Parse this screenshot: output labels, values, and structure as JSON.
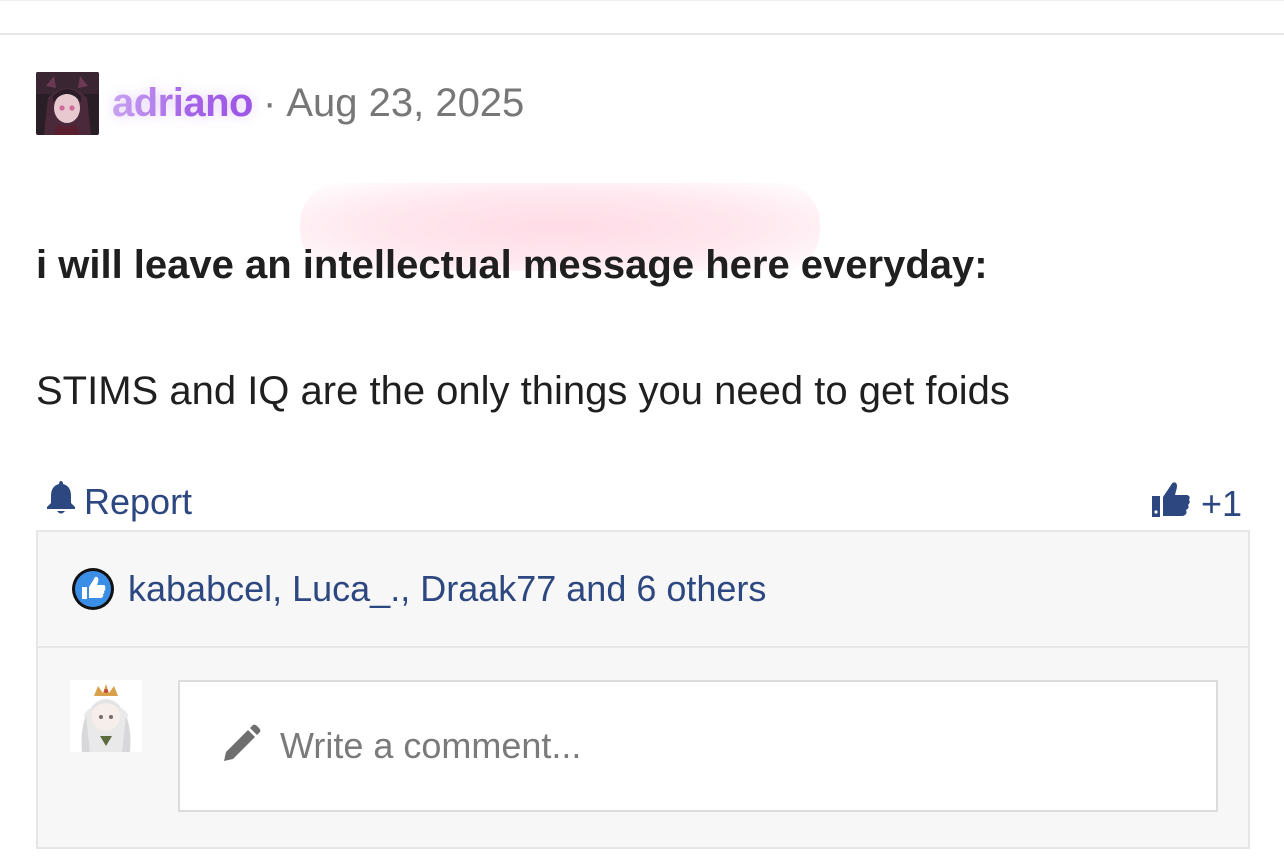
{
  "post": {
    "author": "adriano",
    "separator": "·",
    "date": "Aug 23, 2025",
    "title": "i will leave an intellectual message here everyday:",
    "body": "STIMS and IQ are the only things you need to get foids"
  },
  "actions": {
    "report_label": "Report",
    "report_icon": "bell-icon",
    "like_count": "+1",
    "like_icon": "thumbs-up-icon"
  },
  "reactions": {
    "icon": "like-badge-icon",
    "summary": "kababcel, Luca_., Draak77 and 6 others"
  },
  "comment_box": {
    "placeholder": "Write a comment...",
    "icon": "pencil-icon"
  },
  "colors": {
    "author_gradient_start": "#c8a3f0",
    "author_gradient_end": "#9b56e6",
    "link_blue": "#2d4780",
    "highlight_pink": "#ffc4d6",
    "like_badge_blue": "#3b8ee6"
  }
}
